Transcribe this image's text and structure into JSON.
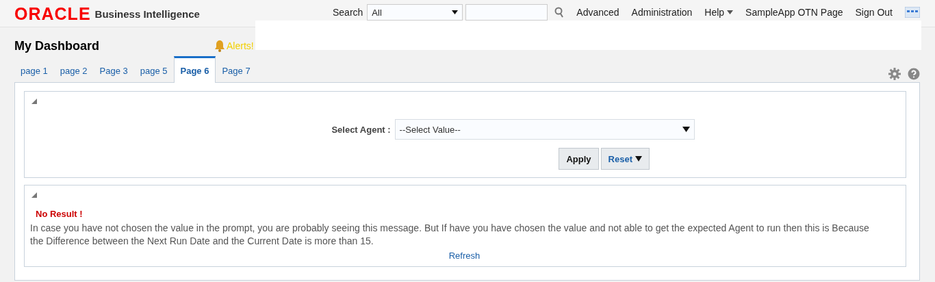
{
  "header": {
    "brand": "ORACLE",
    "product": "Business Intelligence",
    "search_label": "Search",
    "search_scope": "All",
    "links": [
      {
        "label": "Advanced",
        "kind": "link"
      },
      {
        "label": "Administration",
        "kind": "link"
      },
      {
        "label": "Help",
        "kind": "menu"
      },
      {
        "label": "SampleApp OTN Page",
        "kind": "link"
      },
      {
        "label": "Sign Out",
        "kind": "link"
      }
    ]
  },
  "dashboard": {
    "title": "My Dashboard",
    "alerts": "Alerts!"
  },
  "tabs": [
    {
      "label": "page 1",
      "selected": false
    },
    {
      "label": "page 2",
      "selected": false
    },
    {
      "label": "Page 3",
      "selected": false
    },
    {
      "label": "page 5",
      "selected": false
    },
    {
      "label": "Page 6",
      "selected": true
    },
    {
      "label": "Page 7",
      "selected": false
    }
  ],
  "prompt": {
    "label": "Select Agent :",
    "value": "--Select Value--",
    "apply": "Apply",
    "reset": "Reset"
  },
  "result": {
    "title": "No Result !",
    "message": "In case you have not chosen the value in the prompt, you are probably seeing this message. But If have you have chosen the value and not able to get the expected Agent to run then this is Because the Difference between the Next Run Date and the Current Date is more than 15.",
    "refresh": "Refresh"
  }
}
